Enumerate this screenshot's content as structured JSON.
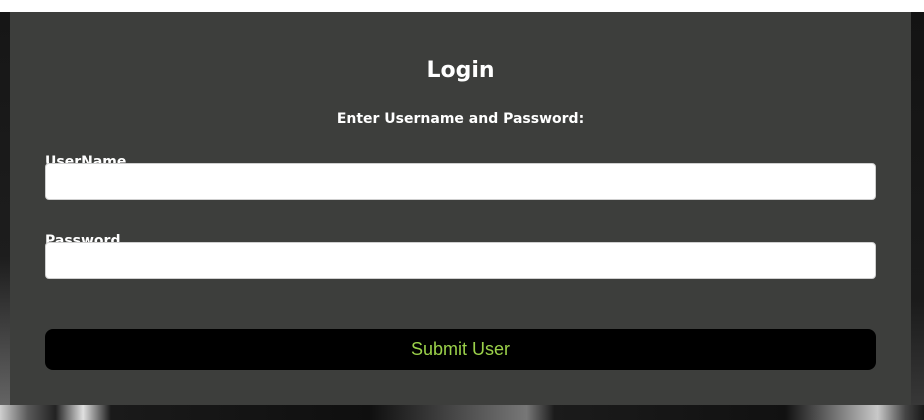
{
  "login": {
    "title": "Login",
    "subtitle": "Enter Username and Password:",
    "username_label": "UserName",
    "username_value": "",
    "password_label": "Password",
    "password_value": "",
    "submit_label": "Submit User"
  },
  "colors": {
    "panel_background": "#3d3e3c",
    "submit_background": "#000000",
    "submit_text": "#9bd14a",
    "label_text": "#ffffff"
  }
}
